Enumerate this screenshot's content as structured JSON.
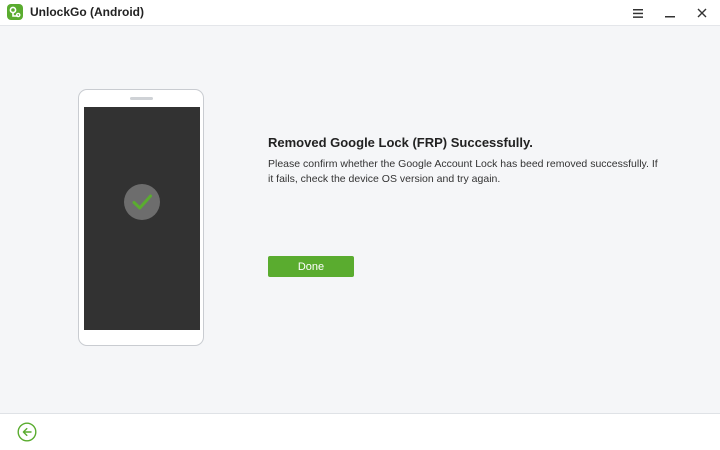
{
  "window": {
    "title": "UnlockGo (Android)",
    "controls": [
      "menu-icon",
      "minimize-icon",
      "close-icon"
    ]
  },
  "colors": {
    "accent": "#5aac2f",
    "screen": "#323232",
    "background": "#f5f6f8"
  },
  "main": {
    "heading": "Removed Google Lock (FRP) Successfully.",
    "description": "Please confirm whether the Google Account Lock has beed removed successfully. If it fails, check the device OS version and try again.",
    "done_label": "Done"
  },
  "footer": {
    "back_icon": "back-arrow-icon"
  }
}
